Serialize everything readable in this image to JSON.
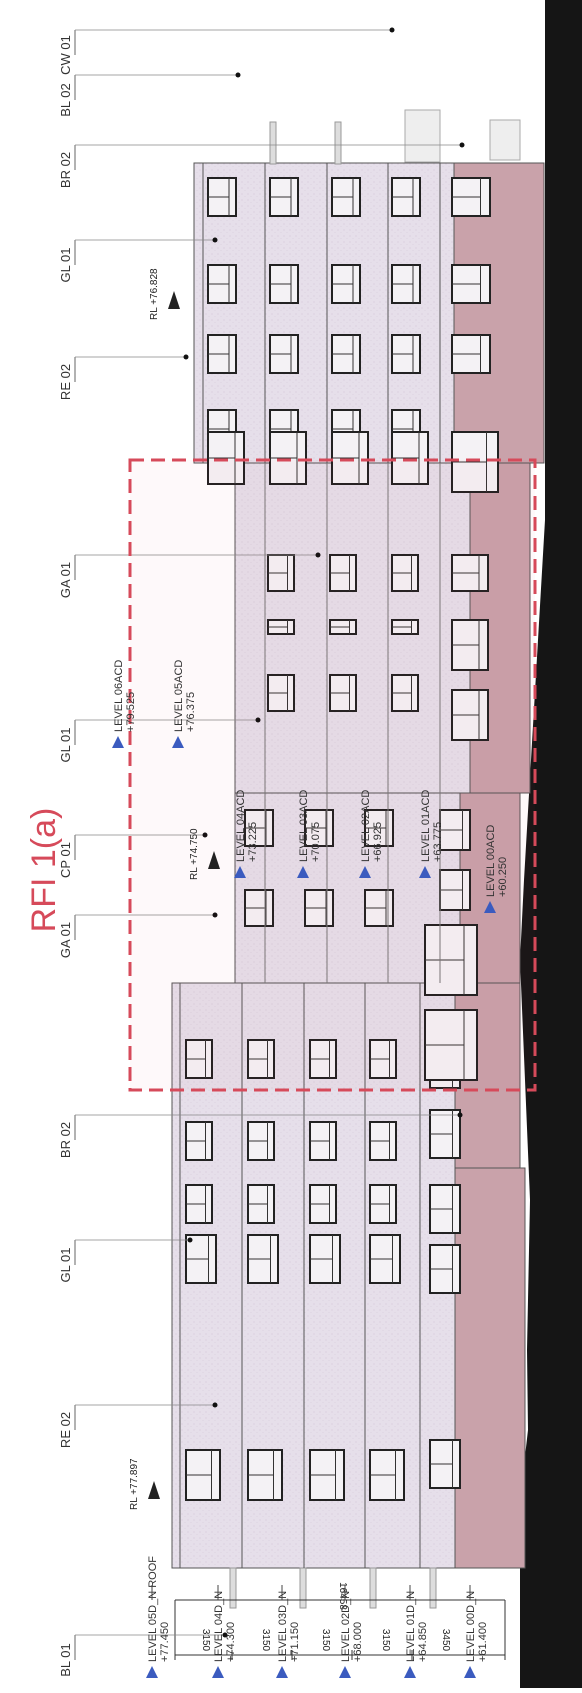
{
  "rfi_label": "RFI 1(a)",
  "material_tags": [
    "CW 01",
    "BL 02",
    "BR 02",
    "GL 01",
    "RE 02",
    "GA 01",
    "GL 01",
    "CP 01",
    "GA 01",
    "BR 02",
    "GL 01",
    "RE 02",
    "BL 01"
  ],
  "overall_dimension": "16458",
  "floor_dimensions": [
    "3150",
    "3150",
    "3150",
    "3150",
    "3450"
  ],
  "left_levels": [
    {
      "name": "LEVEL 05D_N ROOF",
      "rl": "+77.450"
    },
    {
      "name": "LEVEL 04D_N",
      "rl": "+74.300"
    },
    {
      "name": "LEVEL 03D_N",
      "rl": "+71.150"
    },
    {
      "name": "LEVEL 02D_N",
      "rl": "+68.000"
    },
    {
      "name": "LEVEL 01D_N",
      "rl": "+64.850"
    },
    {
      "name": "LEVEL 00D_N",
      "rl": "+61.400"
    }
  ],
  "center_levels": [
    {
      "name": "LEVEL 06ACD",
      "rl": "+79.525"
    },
    {
      "name": "LEVEL 05ACD",
      "rl": "+76.375"
    },
    {
      "name": "LEVEL 04ACD",
      "rl": "+73.225"
    },
    {
      "name": "LEVEL 03ACD",
      "rl": "+70.075"
    },
    {
      "name": "LEVEL 02ACD",
      "rl": "+66.925"
    },
    {
      "name": "LEVEL 01ACD",
      "rl": "+63.775"
    },
    {
      "name": "LEVEL 00ACD",
      "rl": "+60.250"
    }
  ],
  "rl_markers": [
    "RL +76.828",
    "RL +74.750",
    "RL +77.897"
  ],
  "colors": {
    "rfi_red": "#d64a5a",
    "facade": "#e8e1ec",
    "base_pink": "#c9a2aa",
    "level_marker": "#3b5bbf",
    "ground": "#151515"
  }
}
